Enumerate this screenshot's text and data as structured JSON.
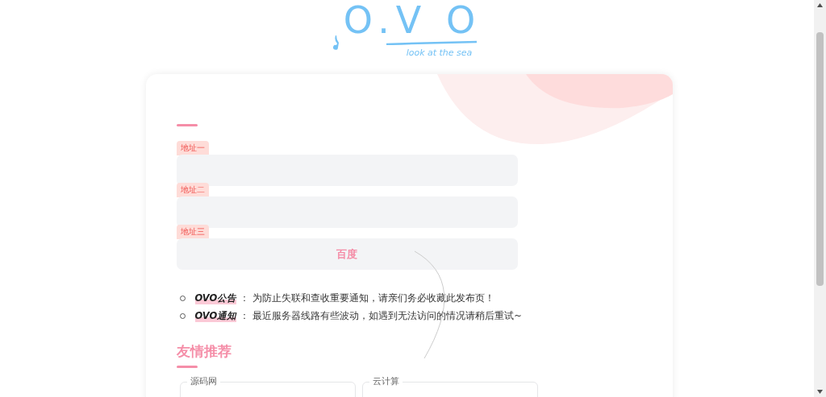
{
  "logo": {
    "title": "O.V O",
    "tagline": "look at the sea"
  },
  "fields": [
    {
      "label": "地址一"
    },
    {
      "label": "地址二"
    },
    {
      "label": "地址三",
      "value": "百度"
    }
  ],
  "notices": [
    {
      "title": "OVO公告",
      "separator": "：",
      "text": "为防止失联和查收重要通知，请亲们务必收藏此发布页！"
    },
    {
      "title": "OVO通知",
      "separator": "：",
      "text": "最近服务器线路有些波动，如遇到无法访问的情况请稍后重试~"
    }
  ],
  "recommend": {
    "heading": "友情推荐",
    "groups": [
      {
        "legend": "源码网"
      },
      {
        "legend": "云计算"
      }
    ]
  }
}
